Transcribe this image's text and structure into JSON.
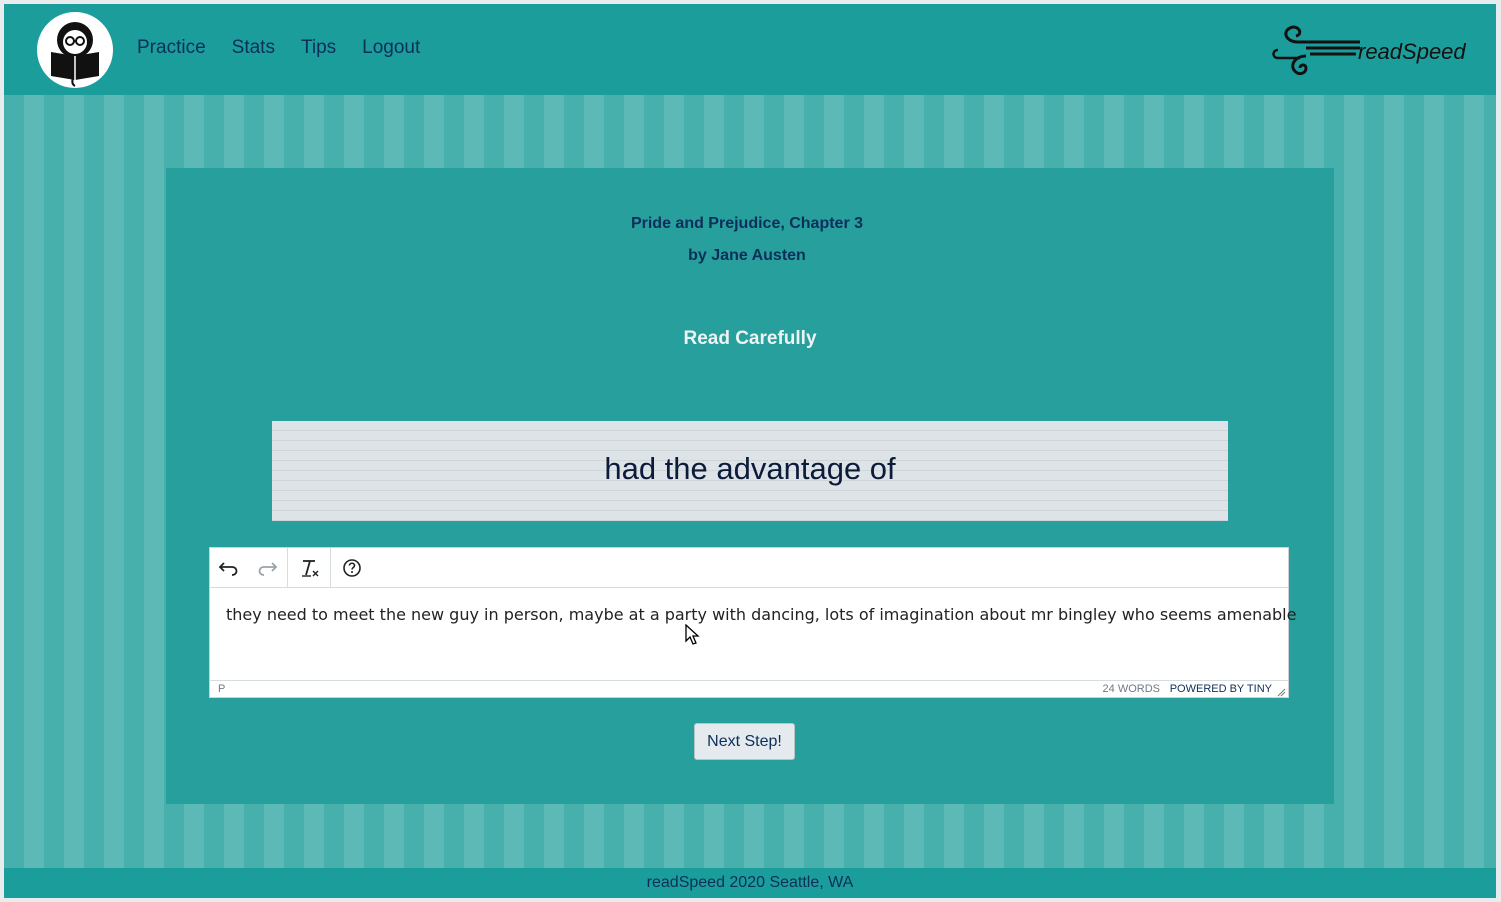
{
  "nav": {
    "links": [
      "Practice",
      "Stats",
      "Tips",
      "Logout"
    ],
    "brand": "readSpeed"
  },
  "content": {
    "title": "Pride and Prejudice, Chapter 3",
    "author": "by Jane Austen",
    "instruction": "Read Carefully",
    "reading_text": "had the advantage of"
  },
  "editor": {
    "toolbar_icons": [
      "undo-icon",
      "redo-icon",
      "clear-formatting-icon",
      "help-icon"
    ],
    "text": "they need to meet the new guy in person, maybe at a party with dancing, lots of imagination about mr bingley who seems amenable",
    "status_path": "P",
    "word_count": "24 WORDS",
    "powered_by": "POWERED BY TINY"
  },
  "actions": {
    "next_label": "Next Step!"
  },
  "footer": {
    "text": "readSpeed 2020 Seattle, WA"
  },
  "colors": {
    "nav_bg": "#1b9e9b",
    "panel_bg": "#279f9c",
    "page_stripe_a": "#47afac",
    "page_stripe_b": "#5db9b6",
    "link_text": "#0c2f5a",
    "instruction_text": "#ecf4f4"
  }
}
